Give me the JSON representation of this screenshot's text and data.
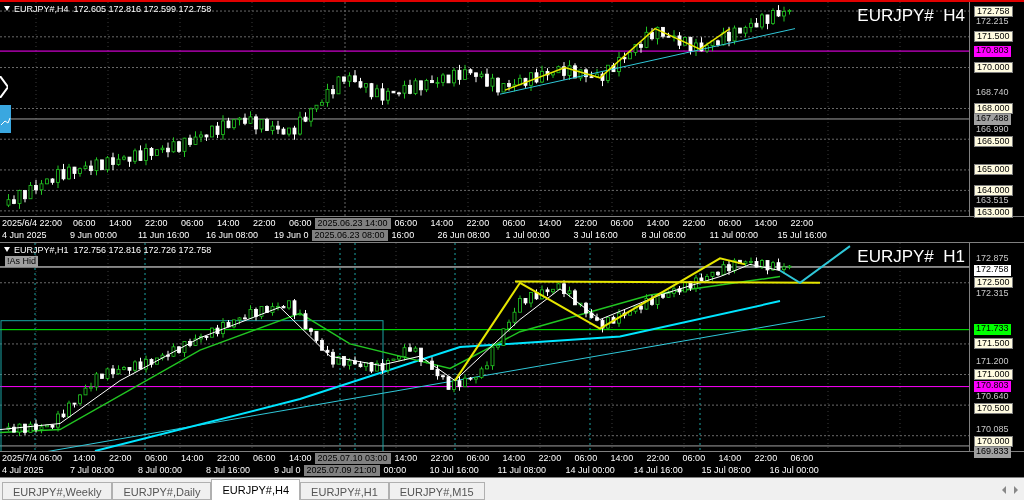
{
  "panes": [
    {
      "header": "EURJPY#,H4  172.605 172.816 172.599 172.758",
      "title": "EURJPY#  H4",
      "price_labels": [
        {
          "text": "172.758",
          "kind": "level"
        },
        {
          "text": "172.215",
          "kind": "tick"
        },
        {
          "text": "171.500",
          "kind": "level"
        },
        {
          "text": "170.803",
          "kind": "marker",
          "color": "#ff00ff"
        },
        {
          "text": "170.000",
          "kind": "level"
        },
        {
          "text": "168.740",
          "kind": "tick"
        },
        {
          "text": "168.000",
          "kind": "level"
        },
        {
          "text": "167.488",
          "kind": "marker",
          "color": "#a0a0a0"
        },
        {
          "text": "166.990",
          "kind": "tick"
        },
        {
          "text": "166.500",
          "kind": "level"
        },
        {
          "text": "165.000",
          "kind": "level"
        },
        {
          "text": "164.000",
          "kind": "level"
        },
        {
          "text": "163.515",
          "kind": "tick"
        },
        {
          "text": "163.000",
          "kind": "level"
        }
      ],
      "grid_labels": [
        {
          "text": "2025/6/4 22:00",
          "kind": "tick"
        },
        {
          "text": "06:00",
          "kind": "tick"
        },
        {
          "text": "14:00",
          "kind": "tick"
        },
        {
          "text": "22:00",
          "kind": "tick"
        },
        {
          "text": "06:00",
          "kind": "tick"
        },
        {
          "text": "14:00",
          "kind": "tick"
        },
        {
          "text": "22:00",
          "kind": "tick"
        },
        {
          "text": "06:00",
          "kind": "tick"
        },
        {
          "text": "2025.06.23 14:00",
          "kind": "cursor"
        },
        {
          "text": "06:00",
          "kind": "tick"
        },
        {
          "text": "14:00",
          "kind": "tick"
        },
        {
          "text": "22:00",
          "kind": "tick"
        },
        {
          "text": "06:00",
          "kind": "tick"
        },
        {
          "text": "14:00",
          "kind": "tick"
        },
        {
          "text": "22:00",
          "kind": "tick"
        },
        {
          "text": "06:00",
          "kind": "tick"
        },
        {
          "text": "14:00",
          "kind": "tick"
        },
        {
          "text": "22:00",
          "kind": "tick"
        },
        {
          "text": "06:00",
          "kind": "tick"
        },
        {
          "text": "14:00",
          "kind": "tick"
        },
        {
          "text": "22:00",
          "kind": "tick"
        }
      ],
      "date_labels": [
        {
          "text": "4 Jun 2025",
          "kind": "tick"
        },
        {
          "text": "9 Jun 00:00",
          "kind": "tick"
        },
        {
          "text": "11 Jun 16:00",
          "kind": "tick"
        },
        {
          "text": "16 Jun 08:00",
          "kind": "tick"
        },
        {
          "text": "19 Jun 0",
          "kind": "tick"
        },
        {
          "text": "2025.06.23 08:00",
          "kind": "cursor"
        },
        {
          "text": "16:00",
          "kind": "tick"
        },
        {
          "text": "26 Jun 08:00",
          "kind": "tick"
        },
        {
          "text": "1 Jul 00:00",
          "kind": "tick"
        },
        {
          "text": "3 Jul 16:00",
          "kind": "tick"
        },
        {
          "text": "8 Jul 08:00",
          "kind": "tick"
        },
        {
          "text": "11 Jul 00:00",
          "kind": "tick"
        },
        {
          "text": "15 Jul 16:00",
          "kind": "tick"
        }
      ]
    },
    {
      "header": "EURJPY#,H1  172.756 172.816 172.726 172.758",
      "title": "EURJPY#  H1",
      "button": "!As Hid",
      "price_labels": [
        {
          "text": "172.875",
          "kind": "tick"
        },
        {
          "text": "172.758",
          "kind": "marker",
          "color": "#ffffff"
        },
        {
          "text": "172.500",
          "kind": "level"
        },
        {
          "text": "172.315",
          "kind": "tick"
        },
        {
          "text": "171.733",
          "kind": "marker",
          "color": "#00ff00"
        },
        {
          "text": "171.500",
          "kind": "level"
        },
        {
          "text": "171.200",
          "kind": "tick"
        },
        {
          "text": "171.000",
          "kind": "level"
        },
        {
          "text": "170.803",
          "kind": "marker",
          "color": "#ff00ff"
        },
        {
          "text": "170.640",
          "kind": "tick"
        },
        {
          "text": "170.500",
          "kind": "level"
        },
        {
          "text": "170.085",
          "kind": "tick"
        },
        {
          "text": "170.000",
          "kind": "level"
        },
        {
          "text": "169.833",
          "kind": "marker",
          "color": "#a0a0a0"
        }
      ],
      "grid_labels": [
        {
          "text": "2025/7/4 06:00",
          "kind": "tick"
        },
        {
          "text": "14:00",
          "kind": "tick"
        },
        {
          "text": "22:00",
          "kind": "tick"
        },
        {
          "text": "06:00",
          "kind": "tick"
        },
        {
          "text": "14:00",
          "kind": "tick"
        },
        {
          "text": "22:00",
          "kind": "tick"
        },
        {
          "text": "06:00",
          "kind": "tick"
        },
        {
          "text": "14:00",
          "kind": "tick"
        },
        {
          "text": "2025.07.10 03:00",
          "kind": "cursor"
        },
        {
          "text": "14:00",
          "kind": "tick"
        },
        {
          "text": "22:00",
          "kind": "tick"
        },
        {
          "text": "06:00",
          "kind": "tick"
        },
        {
          "text": "14:00",
          "kind": "tick"
        },
        {
          "text": "22:00",
          "kind": "tick"
        },
        {
          "text": "06:00",
          "kind": "tick"
        },
        {
          "text": "14:00",
          "kind": "tick"
        },
        {
          "text": "22:00",
          "kind": "tick"
        },
        {
          "text": "06:00",
          "kind": "tick"
        },
        {
          "text": "14:00",
          "kind": "tick"
        },
        {
          "text": "22:00",
          "kind": "tick"
        },
        {
          "text": "06:00",
          "kind": "tick"
        }
      ],
      "date_labels": [
        {
          "text": "4 Jul 2025",
          "kind": "tick"
        },
        {
          "text": "7 Jul 08:00",
          "kind": "tick"
        },
        {
          "text": "8 Jul 00:00",
          "kind": "tick"
        },
        {
          "text": "8 Jul 16:00",
          "kind": "tick"
        },
        {
          "text": "9 Jul 0",
          "kind": "tick"
        },
        {
          "text": "2025.07.09 21:00",
          "kind": "cursor"
        },
        {
          "text": "00:00",
          "kind": "tick"
        },
        {
          "text": "10 Jul 16:00",
          "kind": "tick"
        },
        {
          "text": "11 Jul 08:00",
          "kind": "tick"
        },
        {
          "text": "14 Jul 00:00",
          "kind": "tick"
        },
        {
          "text": "14 Jul 16:00",
          "kind": "tick"
        },
        {
          "text": "15 Jul 08:00",
          "kind": "tick"
        },
        {
          "text": "16 Jul 00:00",
          "kind": "tick"
        }
      ]
    }
  ],
  "tabs": [
    {
      "label": "EURJPY#,Weekly",
      "selected": false
    },
    {
      "label": "EURJPY#,Daily",
      "selected": false
    },
    {
      "label": "EURJPY#,H4",
      "selected": true
    },
    {
      "label": "EURJPY#,H1",
      "selected": false
    },
    {
      "label": "EURJPY#,M15",
      "selected": false
    }
  ]
}
